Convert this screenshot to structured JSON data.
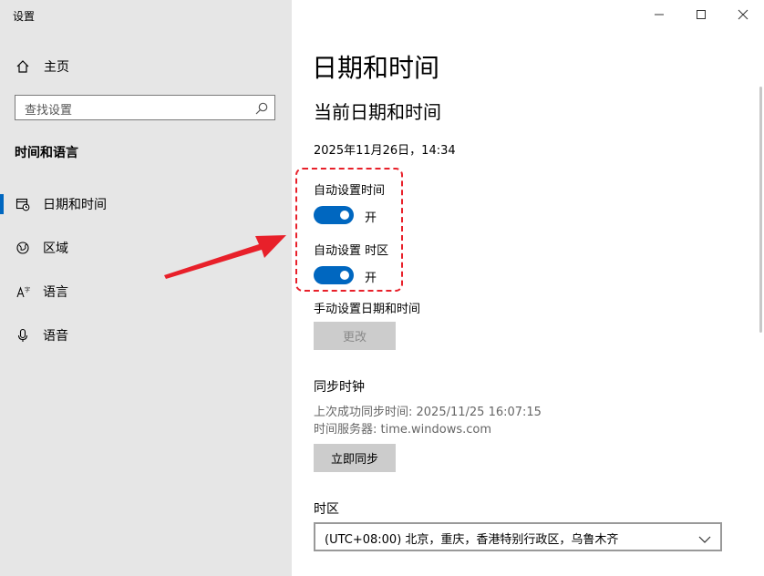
{
  "window": {
    "title": "设置"
  },
  "sidebar": {
    "home_label": "主页",
    "search_placeholder": "查找设置",
    "section_title": "时间和语言",
    "items": [
      {
        "label": "日期和时间",
        "icon": "calendar-clock-icon",
        "active": true
      },
      {
        "label": "区域",
        "icon": "globe-icon",
        "active": false
      },
      {
        "label": "语言",
        "icon": "language-icon",
        "active": false
      },
      {
        "label": "语音",
        "icon": "microphone-icon",
        "active": false
      }
    ]
  },
  "main": {
    "page_title": "日期和时间",
    "current_heading": "当前日期和时间",
    "current_datetime": "2025年11月26日，14:34",
    "auto_time": {
      "label": "自动设置时间",
      "state": "开"
    },
    "auto_timezone": {
      "label": "自动设置 时区",
      "state": "开"
    },
    "manual_label": "手动设置日期和时间",
    "change_button": "更改",
    "sync_heading": "同步时钟",
    "last_sync": "上次成功同步时间: 2025/11/25 16:07:15",
    "time_server": "时间服务器: time.windows.com",
    "sync_button": "立即同步",
    "timezone_heading": "时区",
    "timezone_value": "(UTC+08:00) 北京，重庆，香港特别行政区，乌鲁木齐"
  },
  "colors": {
    "accent": "#0067c0",
    "annotation": "#e8202a",
    "sidebar_bg": "#e6e6e6"
  }
}
